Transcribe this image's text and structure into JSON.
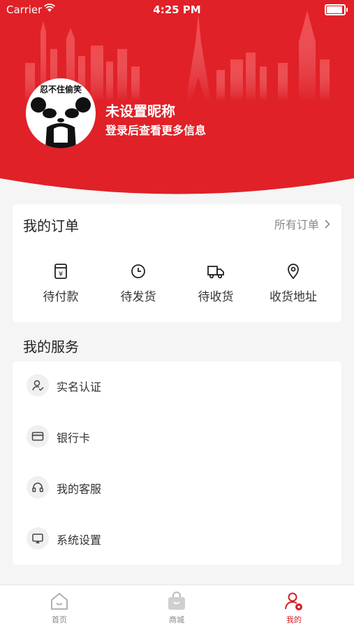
{
  "status_bar": {
    "carrier": "Carrier",
    "time": "4:25 PM",
    "battery_level": 0.9
  },
  "profile": {
    "avatar_text": "忍不住偷笑",
    "nickname": "未设置昵称",
    "subtitle": "登录后查看更多信息"
  },
  "orders": {
    "title": "我的订单",
    "all_label": "所有订单",
    "items": [
      {
        "label": "待付款",
        "icon": "payment-icon"
      },
      {
        "label": "待发货",
        "icon": "clock-icon"
      },
      {
        "label": "待收货",
        "icon": "truck-icon"
      },
      {
        "label": "收货地址",
        "icon": "location-icon"
      }
    ]
  },
  "services": {
    "title": "我的服务",
    "items": [
      {
        "label": "实名认证",
        "icon": "user-verify-icon"
      },
      {
        "label": "银行卡",
        "icon": "card-icon"
      },
      {
        "label": "我的客服",
        "icon": "headset-icon"
      },
      {
        "label": "系统设置",
        "icon": "settings-icon"
      }
    ]
  },
  "tabbar": {
    "items": [
      {
        "label": "首页",
        "icon": "home-icon",
        "active": false
      },
      {
        "label": "商城",
        "icon": "shop-bag-icon",
        "active": false
      },
      {
        "label": "我的",
        "icon": "profile-icon",
        "active": true
      }
    ]
  },
  "colors": {
    "brand_red": "#e02128",
    "background": "#f5f5f5",
    "text_dark": "#222222",
    "text_muted": "#888888"
  }
}
